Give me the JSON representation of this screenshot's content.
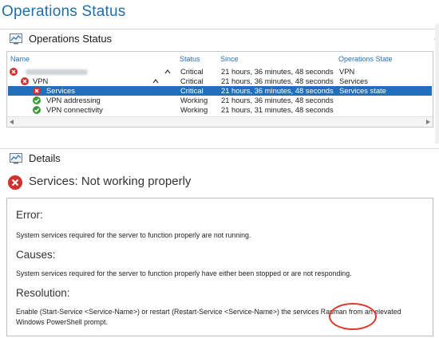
{
  "page": {
    "title": "Operations Status"
  },
  "ops_panel": {
    "title": "Operations Status"
  },
  "table": {
    "columns": [
      "Name",
      "Status",
      "Since",
      "Operations State"
    ],
    "rows": [
      {
        "name": "",
        "status": "Critical",
        "since": "21 hours, 36 minutes, 48 seconds",
        "state": "VPN",
        "icon": "error-icon",
        "level": 0,
        "chevron": "up"
      },
      {
        "name": "VPN",
        "status": "Critical",
        "since": "21 hours, 36 minutes, 48 seconds",
        "state": "Services",
        "icon": "error-icon",
        "level": 1,
        "chevron": "up"
      },
      {
        "name": "Services",
        "status": "Critical",
        "since": "21 hours, 36 minutes, 48 seconds",
        "state": "Services state",
        "icon": "error-icon",
        "level": 2,
        "selected": true
      },
      {
        "name": "VPN addressing",
        "status": "Working",
        "since": "21 hours, 36 minutes, 48 seconds",
        "state": "",
        "icon": "check-icon",
        "level": 2
      },
      {
        "name": "VPN connectivity",
        "status": "Working",
        "since": "21 hours, 31 minutes, 48 seconds",
        "state": "",
        "icon": "check-icon",
        "level": 2
      }
    ]
  },
  "details_panel": {
    "title": "Details"
  },
  "details": {
    "heading": "Services: Not working properly",
    "error_label": "Error:",
    "error_text": "System services required for the server to function properly are not running.",
    "causes_label": "Causes:",
    "causes_text": "System services required for the server to function properly have either been stopped or are not responding.",
    "resolution_label": "Resolution:",
    "resolution_text": "Enable (Start-Service <Service-Name>) or restart (Restart-Service <Service-Name>) the services Rasman from an elevated Windows PowerShell prompt."
  },
  "colors": {
    "accent": "#1f6fbd",
    "error": "#d32f2f",
    "ok": "#3e9b3a",
    "annotation": "#e0352b"
  }
}
